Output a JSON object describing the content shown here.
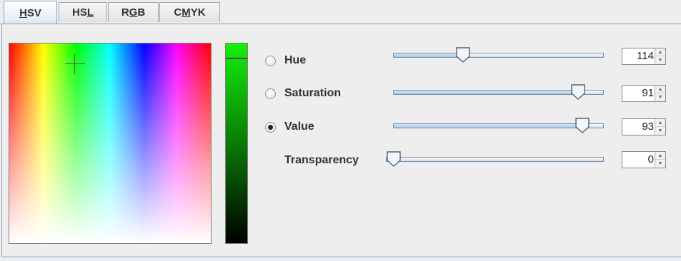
{
  "tabs": {
    "hsv": {
      "pre": "",
      "u": "H",
      "post": "SV"
    },
    "hsl": {
      "pre": "HS",
      "u": "L",
      "post": ""
    },
    "rgb": {
      "pre": "R",
      "u": "G",
      "post": "B"
    },
    "cmyk": {
      "pre": "C",
      "u": "M",
      "post": "YK"
    }
  },
  "active_tab": "HSV",
  "rows": {
    "hue": {
      "label": "Hue",
      "value": "114",
      "fraction": 0.32,
      "selected": false
    },
    "saturation": {
      "label": "Saturation",
      "value": "91",
      "fraction": 0.91,
      "selected": false
    },
    "value": {
      "label": "Value",
      "value": "93",
      "fraction": 0.93,
      "selected": true
    },
    "transparency": {
      "label": "Transparency",
      "value": "0",
      "fraction": 0.0
    }
  },
  "colors": {
    "accent": "#8ea4b8",
    "value_strip_top": "#14f009"
  },
  "icons": {
    "spinner_up": "▲",
    "spinner_down": "▼"
  }
}
